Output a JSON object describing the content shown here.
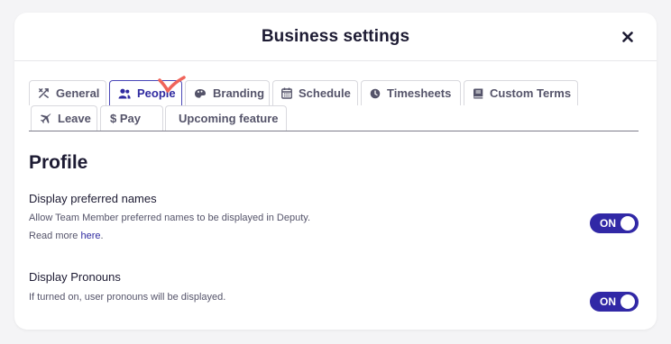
{
  "modal": {
    "title": "Business settings"
  },
  "tabs": [
    {
      "label": "General",
      "icon": "tools-icon"
    },
    {
      "label": "People",
      "icon": "people-icon",
      "active": true
    },
    {
      "label": "Branding",
      "icon": "palette-icon"
    },
    {
      "label": "Schedule",
      "icon": "calendar-icon"
    },
    {
      "label": "Timesheets",
      "icon": "clock-icon"
    },
    {
      "label": "Custom Terms",
      "icon": "book-icon"
    },
    {
      "label": "Leave",
      "icon": "plane-icon"
    },
    {
      "label": "$ Pay",
      "icon": ""
    },
    {
      "label": "Upcoming feature",
      "icon": ""
    }
  ],
  "content": {
    "section_title": "Profile",
    "settings": [
      {
        "title": "Display preferred names",
        "description": "Allow Team Member preferred names to be displayed in Deputy.",
        "read_more_prefix": "Read more",
        "read_more_link": "here",
        "read_more_suffix": ".",
        "toggle_label": "ON",
        "enabled": true
      },
      {
        "title": "Display Pronouns",
        "description": "If turned on, user pronouns will be displayed.",
        "toggle_label": "ON",
        "enabled": true
      }
    ]
  },
  "colors": {
    "accent": "#3128a6",
    "active_tab": "#2f2aa0",
    "annotation": "#f0645a"
  }
}
